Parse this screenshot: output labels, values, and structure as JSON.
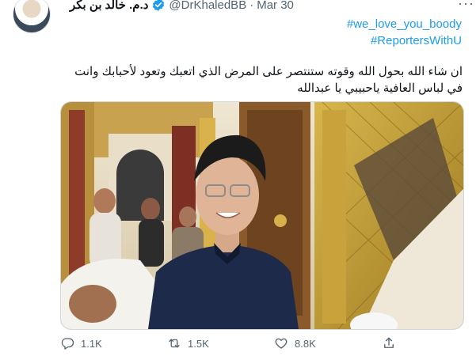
{
  "tweet": {
    "display_name": "د.م. خالد بن بكر",
    "handle": "@DrKhaledBB",
    "separator": "·",
    "time": "Mar 30",
    "more_label": "···",
    "hashtags": [
      "#we_love_you_boody",
      "#ReportersWithU"
    ],
    "text_line1": "ان شاء الله بحول الله وقوته ستنتصر على المرض الذي اتعبك وتعود لأحبابك وانت",
    "text_line2": "في لباس العافية ياحبيبي يا عبدالله",
    "verified": true
  },
  "actions": {
    "reply_count": "1.1K",
    "retweet_count": "1.5K",
    "like_count": "8.8K"
  },
  "icons": {
    "reply": "reply-icon",
    "retweet": "retweet-icon",
    "like": "heart-icon",
    "share": "share-icon",
    "verified": "verified-badge-icon"
  },
  "colors": {
    "link": "#1d9bf0",
    "secondary_text": "#536471",
    "primary_text": "#0f1419",
    "background": "#ffffff"
  }
}
